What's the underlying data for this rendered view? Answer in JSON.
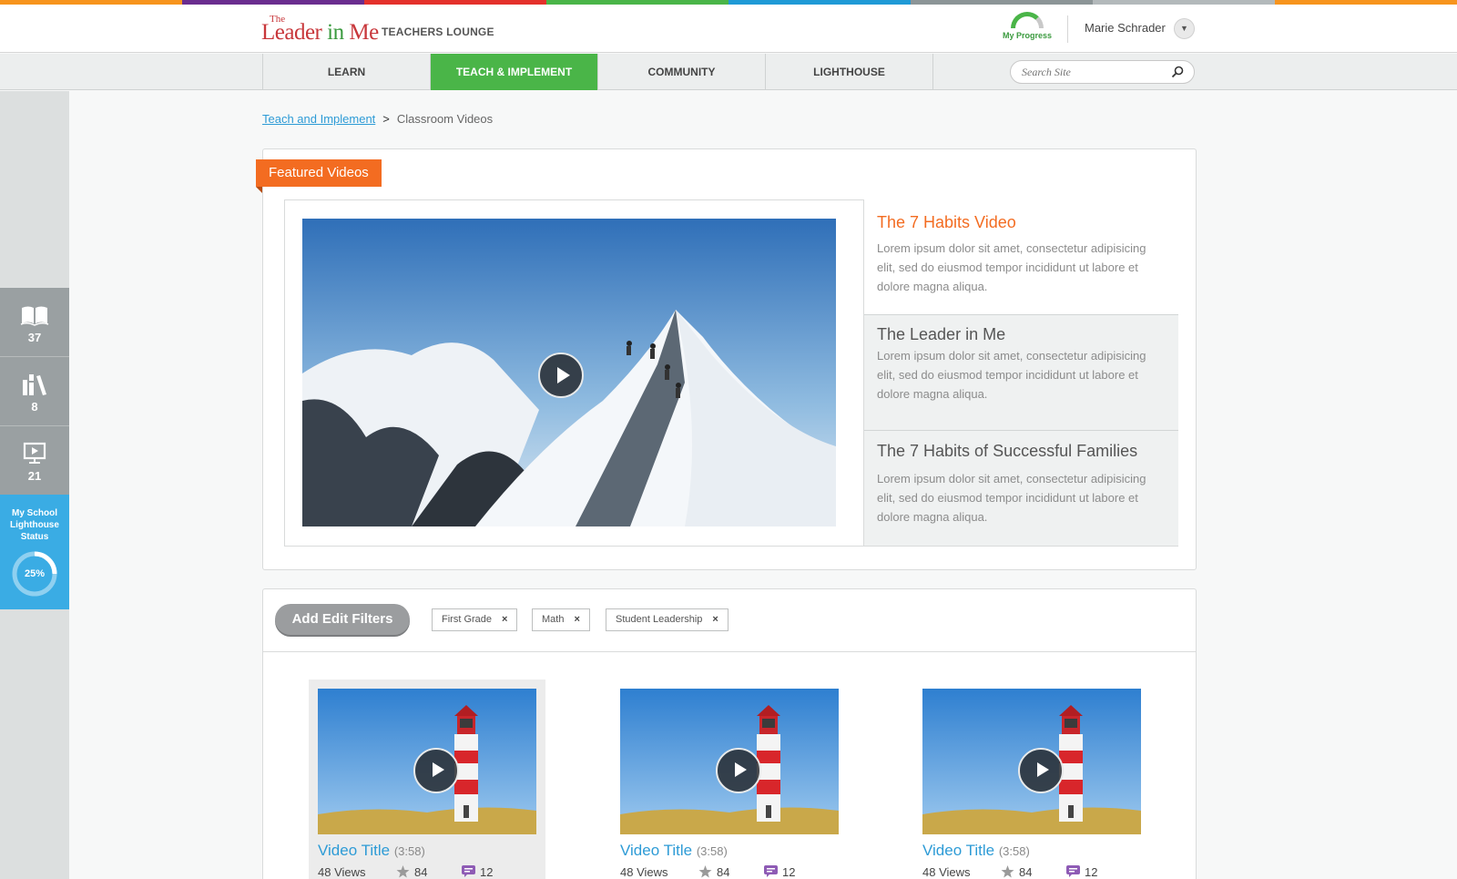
{
  "colors": {
    "strip": [
      "#f7941d",
      "#6a2d8f",
      "#e4312b",
      "#4ab548",
      "#1f9ad6",
      "#8c9597",
      "#b3b9bb",
      "#f7941d"
    ],
    "accent_orange": "#f36c21",
    "accent_green": "#4ab548",
    "accent_blue": "#2d9bd6",
    "sidebar_status": "#3aace4"
  },
  "header": {
    "logo_the": "The",
    "logo_leader": "Leader",
    "logo_in": "in",
    "logo_me": "Me",
    "section": "TEACHERS LOUNGE",
    "progress_label": "My Progress",
    "user_name": "Marie Schrader"
  },
  "nav": {
    "items": [
      {
        "label": "LEARN"
      },
      {
        "label": "TEACH & IMPLEMENT",
        "active": true
      },
      {
        "label": "COMMUNITY"
      },
      {
        "label": "LIGHTHOUSE"
      }
    ],
    "search_placeholder": "Search Site"
  },
  "sidebar": {
    "items": [
      {
        "icon": "book-icon",
        "count": "37"
      },
      {
        "icon": "library-icon",
        "count": "8"
      },
      {
        "icon": "monitor-icon",
        "count": "21"
      }
    ],
    "status_title_1": "My School",
    "status_title_2": "Lighthouse",
    "status_title_3": "Status",
    "status_value": 0.25,
    "status_label": "25%"
  },
  "breadcrumb": {
    "parent": "Teach and Implement",
    "separator": ">",
    "current": "Classroom Videos"
  },
  "featured": {
    "ribbon": "Featured Videos",
    "items": [
      {
        "title": "The 7 Habits Video",
        "desc": "Lorem ipsum dolor sit amet, consectetur adipisicing elit, sed do eiusmod tempor incididunt ut labore et dolore magna aliqua."
      },
      {
        "title": "The Leader in Me",
        "desc": "Lorem ipsum dolor sit amet, consectetur adipisicing elit, sed do eiusmod tempor incididunt ut labore et dolore magna aliqua."
      },
      {
        "title": "The 7 Habits of  Successful Families",
        "desc": "Lorem ipsum dolor sit amet, consectetur adipisicing elit, sed do eiusmod tempor incididunt ut labore et dolore magna aliqua."
      }
    ]
  },
  "filters": {
    "add_label": "Add Edit Filters",
    "chips": [
      "First Grade",
      "Math",
      "Student Leadership"
    ],
    "remove_glyph": "×"
  },
  "videos": [
    {
      "title": "Video Title",
      "duration": "(3:58)",
      "views": "48 Views",
      "stars": "84",
      "comments": "12"
    },
    {
      "title": "Video Title",
      "duration": "(3:58)",
      "views": "48 Views",
      "stars": "84",
      "comments": "12"
    },
    {
      "title": "Video Title",
      "duration": "(3:58)",
      "views": "48 Views",
      "stars": "84",
      "comments": "12"
    }
  ]
}
